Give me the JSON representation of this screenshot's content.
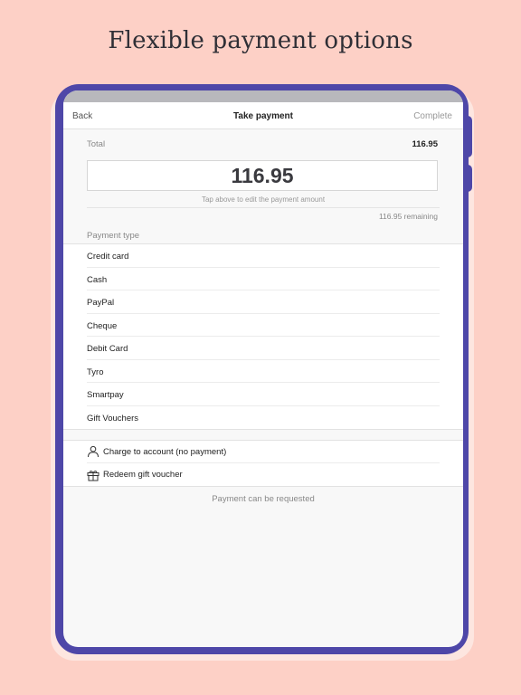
{
  "headline": "Flexible payment options",
  "navbar": {
    "back": "Back",
    "title": "Take payment",
    "complete": "Complete"
  },
  "summary": {
    "total_label": "Total",
    "total_value": "116.95",
    "amount": "116.95",
    "hint": "Tap above to edit the payment amount",
    "remaining": "116.95 remaining"
  },
  "payment_type_label": "Payment type",
  "payment_types": [
    "Credit card",
    "Cash",
    "PayPal",
    "Cheque",
    "Debit Card",
    "Tyro",
    "Smartpay",
    "Gift Vouchers"
  ],
  "actions": {
    "charge_account": "Charge to account (no payment)",
    "redeem_voucher": "Redeem gift voucher"
  },
  "request_note": "Payment can be requested",
  "colors": {
    "background": "#fdd0c6",
    "device_frame": "#4e47a8"
  }
}
